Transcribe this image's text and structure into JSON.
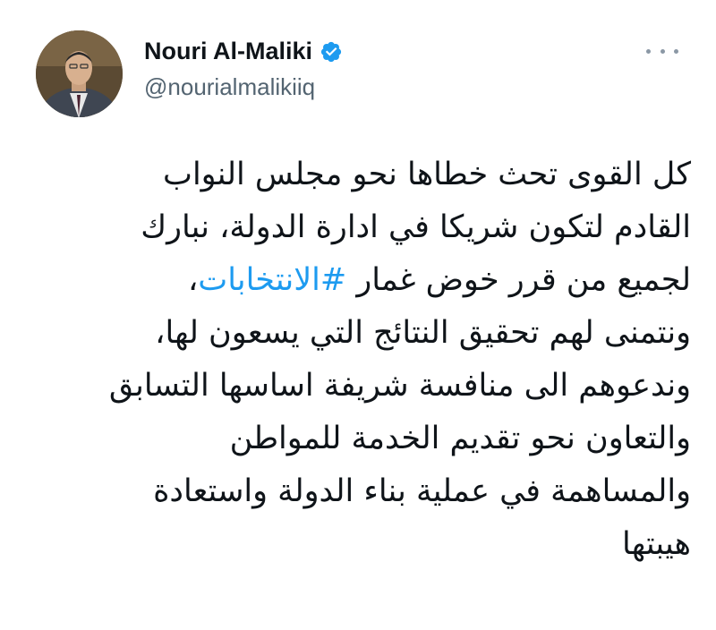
{
  "author": {
    "display_name": "Nouri Al-Maliki",
    "handle": "@nourialmalikiiq",
    "verified": true
  },
  "icons": {
    "verified": "verified-badge-icon",
    "more": "more-options-icon"
  },
  "colors": {
    "hashtag": "#1d9bf0",
    "verified": "#1d9bf0",
    "handle": "#536471"
  },
  "tweet": {
    "line1": "كل القوى تحث خطاها نحو مجلس النواب",
    "line2": "القادم لتكون شريكا في ادارة الدولة، نبارك",
    "line3_before": "لجميع من قرر خوض غمار ",
    "hashtag": "#الانتخابات",
    "line3_after": "،",
    "line4": "ونتمنى لهم تحقيق النتائج التي يسعون لها،",
    "line5": "وندعوهم الى منافسة شريفة اساسها التسابق",
    "line6": "والتعاون نحو تقديم الخدمة للمواطن",
    "line7": "والمساهمة في عملية بناء الدولة واستعادة",
    "line8": "هيبتها"
  }
}
